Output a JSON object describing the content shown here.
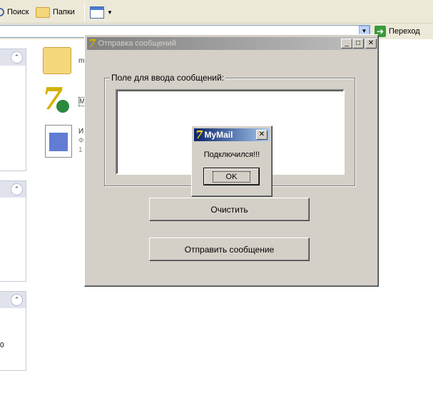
{
  "toolbar": {
    "search_label": "Поиск",
    "folders_label": "Папки"
  },
  "address": {
    "go_label": "Переход"
  },
  "files": [
    {
      "label": "m"
    },
    {
      "label": "M"
    },
    {
      "label": "И",
      "line2": "Ф",
      "line3": "1"
    }
  ],
  "left_pane": {
    "bottom_text": "0"
  },
  "app_window": {
    "title": "Отправка сообщений",
    "group_label": "Поле для ввода сообщений:",
    "message_value": "",
    "clear_label": "Очистить",
    "send_label": "Отправить сообщение"
  },
  "dialog": {
    "title": "MyMail",
    "message": "Подключился!!!",
    "ok_label": "OK"
  },
  "colors": {
    "dialog_title_start": "#0a246a",
    "dialog_title_end": "#a6caf0",
    "inactive_title_start": "#808080",
    "window_face": "#d4d0c8"
  }
}
